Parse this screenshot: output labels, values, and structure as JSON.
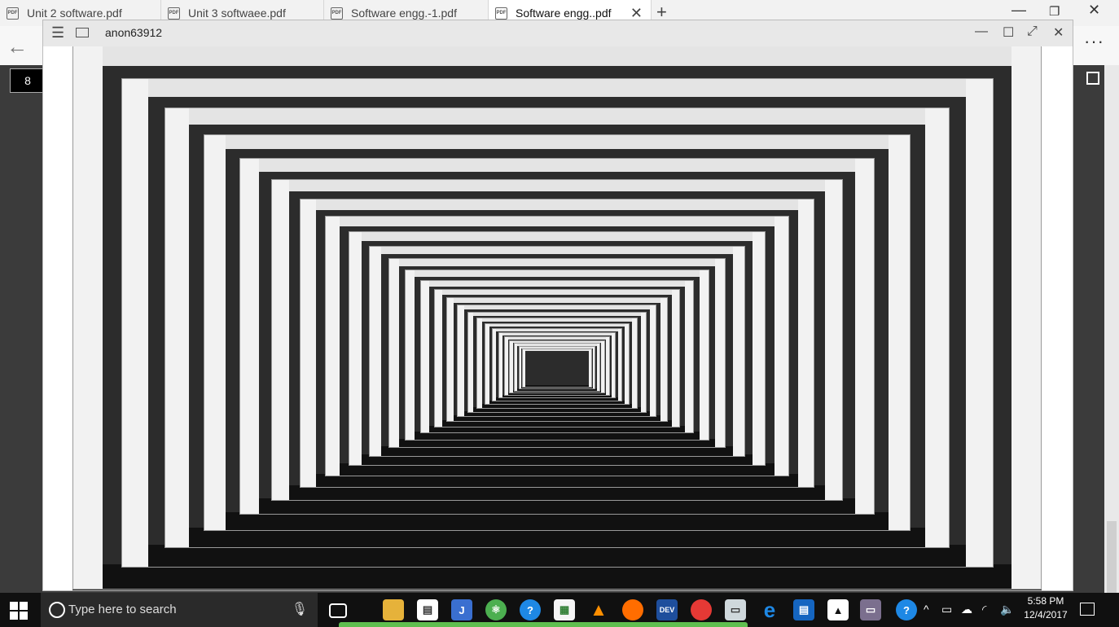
{
  "tabs": [
    {
      "label": "Unit 2 software.pdf"
    },
    {
      "label": "Unit 3 softwaee.pdf"
    },
    {
      "label": "Software engg.-1.pdf"
    },
    {
      "label": "Software engg..pdf",
      "active": true
    }
  ],
  "window": {
    "title": "anon63912"
  },
  "viewer": {
    "page_number": "8"
  },
  "taskbar": {
    "search_placeholder": "Type here to search",
    "time": "5:58 PM",
    "date": "12/4/2017"
  },
  "icons": {
    "new_tab": "plus-icon",
    "back": "back-arrow-icon",
    "more": "more-icon",
    "save": "save-icon"
  },
  "colors": {
    "taskbar_bg": "#101010",
    "tab_active_bg": "#ffffff",
    "viewer_bg": "#3b3b3b",
    "dev_icon": "#1e4e9c",
    "chrome_icon": "#2e7d32"
  }
}
